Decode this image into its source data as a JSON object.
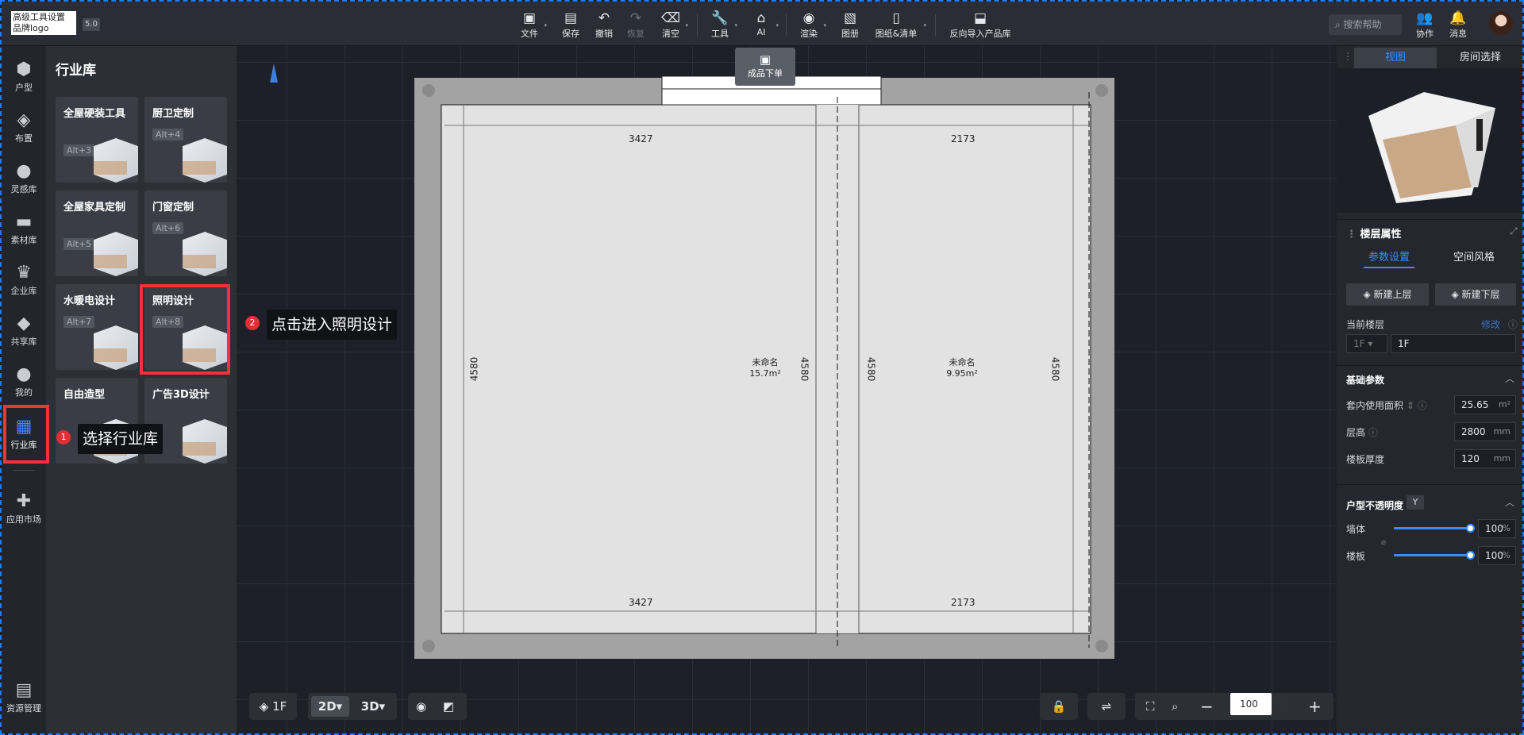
{
  "topbar": {
    "logo_line1": "高级工具设置",
    "logo_line2": "品牌logo",
    "version": "5.0",
    "tools": [
      {
        "label": "文件",
        "icon": "file-icon"
      },
      {
        "label": "保存",
        "icon": "save-icon"
      },
      {
        "label": "撤销",
        "icon": "undo-icon"
      },
      {
        "label": "恢复",
        "icon": "redo-icon"
      },
      {
        "label": "清空",
        "icon": "eraser-icon"
      },
      {
        "label": "工具",
        "icon": "wrench-icon"
      },
      {
        "label": "AI",
        "icon": "ai-icon"
      },
      {
        "label": "渲染",
        "icon": "camera-icon"
      },
      {
        "label": "图册",
        "icon": "album-icon"
      },
      {
        "label": "图纸&清单",
        "icon": "drawing-list-icon"
      },
      {
        "label": "反向导入产品库",
        "icon": "reverse-import-icon"
      }
    ],
    "search_placeholder": "搜索帮助",
    "collab": "协作",
    "messages": "消息"
  },
  "left_nav": {
    "items": [
      "户型",
      "布置",
      "灵感库",
      "素材库",
      "企业库",
      "共享库",
      "我的",
      "行业库",
      "应用市场"
    ],
    "active": "行业库",
    "bottom": "资源管理"
  },
  "panel": {
    "title": "行业库",
    "cards": [
      {
        "title": "全屋硬装工具",
        "key": "Alt+3"
      },
      {
        "title": "厨卫定制",
        "key": "Alt+4"
      },
      {
        "title": "全屋家具定制",
        "key": "Alt+5"
      },
      {
        "title": "门窗定制",
        "key": "Alt+6"
      },
      {
        "title": "水暖电设计",
        "key": "Alt+7"
      },
      {
        "title": "照明设计",
        "key": "Alt+8"
      },
      {
        "title": "自由造型",
        "key": ""
      },
      {
        "title": "广告3D设计",
        "key": ""
      }
    ]
  },
  "annotations": {
    "step1_num": "1",
    "step1_text": "选择行业库",
    "step2_num": "2",
    "step2_text": "点击进入照明设计"
  },
  "canvas": {
    "order_button": "成品下单",
    "rooms": [
      {
        "name": "未命名",
        "area": "15.7m²",
        "width_top": "3427",
        "width_bottom": "3427",
        "height_left": "4580",
        "height_right": "4580"
      },
      {
        "name": "未命名",
        "area": "9.95m²",
        "width_top": "2173",
        "width_bottom": "2173",
        "height_left": "4580",
        "height_right": "4580"
      }
    ]
  },
  "bottom_bar": {
    "floor": "1F",
    "mode_2d": "2D",
    "mode_3d": "3D",
    "zoom_value": "100",
    "zoom_unit": "%"
  },
  "right_panel": {
    "tabs": [
      "视图",
      "房间选择"
    ],
    "active_tab": "视图",
    "section_title": "楼层属性",
    "sub_tabs": [
      "参数设置",
      "空间风格"
    ],
    "active_sub_tab": "参数设置",
    "new_upper": "新建上层",
    "new_lower": "新建下层",
    "current_floor_label": "当前楼层",
    "current_floor_action": "修改",
    "floor_prefix": "1F",
    "floor_value": "1F",
    "basic_params_title": "基础参数",
    "params": [
      {
        "label": "套内使用面积",
        "value": "25.65",
        "unit": "m²"
      },
      {
        "label": "层高",
        "value": "2800",
        "unit": "mm"
      },
      {
        "label": "楼板厚度",
        "value": "120",
        "unit": "mm"
      }
    ],
    "opacity_title": "户型不透明度",
    "opacity_toggle": "Y",
    "opacity": [
      {
        "label": "墙体",
        "value": "100",
        "unit": "%",
        "level": 1.0
      },
      {
        "label": "楼板",
        "value": "100",
        "unit": "%",
        "level": 1.0
      }
    ]
  },
  "colors": {
    "accent": "#3b8cff",
    "highlight": "#f0323a"
  }
}
